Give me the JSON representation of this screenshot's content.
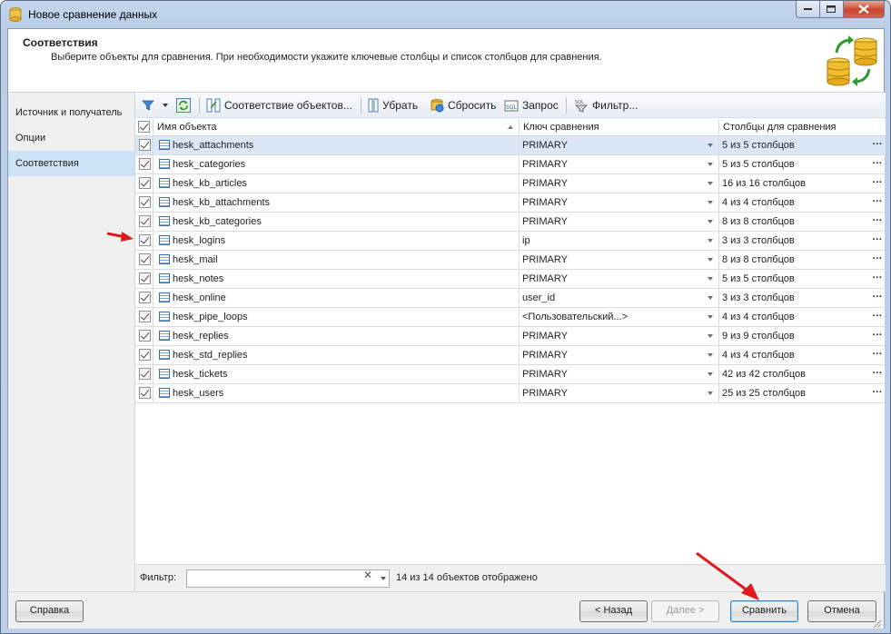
{
  "window": {
    "title": "Новое сравнение данных"
  },
  "header": {
    "title": "Соответствия",
    "subtitle": "Выберите объекты для сравнения. При необходимости укажите ключевые столбцы и список столбцов для сравнения."
  },
  "nav": {
    "items": [
      {
        "label": "Источник и получатель",
        "active": false
      },
      {
        "label": "Опции",
        "active": false
      },
      {
        "label": "Соответствия",
        "active": true
      }
    ]
  },
  "toolbar": {
    "map_objects": "Соответствие объектов...",
    "remove": "Убрать",
    "reset": "Сбросить",
    "query": "Запрос",
    "filter": "Фильтр..."
  },
  "grid": {
    "columns": {
      "name": "Имя объекта",
      "key": "Ключ сравнения",
      "cols": "Столбцы для сравнения"
    },
    "rows": [
      {
        "name": "hesk_attachments",
        "key": "PRIMARY",
        "cols": "5 из 5 столбцов",
        "checked": true,
        "selected": true
      },
      {
        "name": "hesk_categories",
        "key": "PRIMARY",
        "cols": "5 из 5 столбцов",
        "checked": true
      },
      {
        "name": "hesk_kb_articles",
        "key": "PRIMARY",
        "cols": "16 из 16 столбцов",
        "checked": true
      },
      {
        "name": "hesk_kb_attachments",
        "key": "PRIMARY",
        "cols": "4 из 4 столбцов",
        "checked": true
      },
      {
        "name": "hesk_kb_categories",
        "key": "PRIMARY",
        "cols": "8 из 8 столбцов",
        "checked": true
      },
      {
        "name": "hesk_logins",
        "key": "ip",
        "cols": "3 из 3 столбцов",
        "checked": true
      },
      {
        "name": "hesk_mail",
        "key": "PRIMARY",
        "cols": "8 из 8 столбцов",
        "checked": true
      },
      {
        "name": "hesk_notes",
        "key": "PRIMARY",
        "cols": "5 из 5 столбцов",
        "checked": true
      },
      {
        "name": "hesk_online",
        "key": "user_id",
        "cols": "3 из 3 столбцов",
        "checked": true
      },
      {
        "name": "hesk_pipe_loops",
        "key": "<Пользовательский...>",
        "cols": "4 из 4 столбцов",
        "checked": true
      },
      {
        "name": "hesk_replies",
        "key": "PRIMARY",
        "cols": "9 из 9 столбцов",
        "checked": true
      },
      {
        "name": "hesk_std_replies",
        "key": "PRIMARY",
        "cols": "4 из 4 столбцов",
        "checked": true
      },
      {
        "name": "hesk_tickets",
        "key": "PRIMARY",
        "cols": "42 из 42 столбцов",
        "checked": true
      },
      {
        "name": "hesk_users",
        "key": "PRIMARY",
        "cols": "25 из 25 столбцов",
        "checked": true
      }
    ],
    "more_glyph": "···"
  },
  "filter": {
    "label": "Фильтр:",
    "value": "",
    "status": "14 из 14 объектов отображено"
  },
  "buttons": {
    "help": "Справка",
    "back": "< Назад",
    "next": "Далее >",
    "compare": "Сравнить",
    "cancel": "Отмена"
  },
  "colors": {
    "accent_arrow": "#e0191c",
    "selection": "#cde2f5"
  }
}
